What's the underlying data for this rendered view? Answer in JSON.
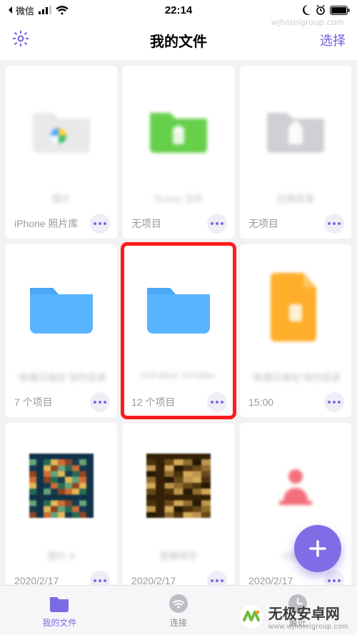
{
  "status": {
    "back_app": "微信",
    "time": "22:14"
  },
  "nav": {
    "title": "我的文件",
    "select": "选择"
  },
  "tiles": [
    {
      "name": "图片",
      "meta": "iPhone 照片库",
      "icon": "photo-folder",
      "highlight": false
    },
    {
      "name": "iTunes 文件",
      "meta": "无项目",
      "icon": "green-folder",
      "highlight": false
    },
    {
      "name": "压缩目录",
      "meta": "无项目",
      "icon": "gray-folder",
      "highlight": false
    },
    {
      "name": "“新建压缩包”目的目录",
      "meta": "7 个项目",
      "icon": "blue-folder",
      "highlight": false
    },
    {
      "name": "KnFabcn XYnDen",
      "meta": "12 个项目",
      "icon": "blue-folder",
      "highlight": true
    },
    {
      "name": "“新建压缩包”目的目录",
      "meta": "15:00",
      "icon": "orange-file",
      "highlight": false
    },
    {
      "name": "图片 A",
      "meta": "2020/2/17",
      "icon": "image-a",
      "highlight": false
    },
    {
      "name": "蒙娜丽莎",
      "meta": "2020/2/17",
      "icon": "image-b",
      "highlight": false
    },
    {
      "name": "小图标",
      "meta": "2020/2/17",
      "icon": "pink-icon",
      "highlight": false
    }
  ],
  "tabs": [
    {
      "label": "我的文件",
      "icon": "folder",
      "active": true
    },
    {
      "label": "连接",
      "icon": "wifi",
      "active": false
    },
    {
      "label": "最近",
      "icon": "clock",
      "active": false
    }
  ],
  "watermark": {
    "top": "wjhotelgroup.com",
    "brand": "无极安卓网",
    "brand_sub": "www.wjhotelgroup.com"
  },
  "colors": {
    "accent": "#7a6be0",
    "highlight_border": "#ff1b1b"
  }
}
